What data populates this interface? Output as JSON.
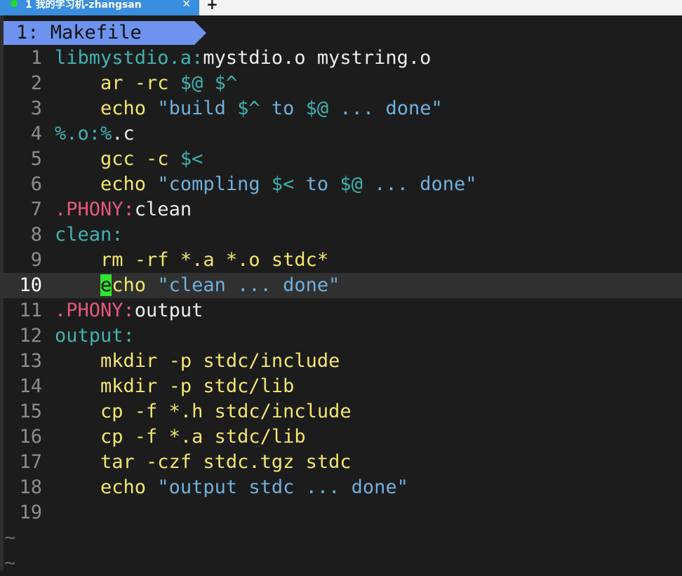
{
  "tab": {
    "title": "1 我的学习机-zhangsan",
    "close": "×",
    "new_tab": "+"
  },
  "buffer": {
    "label": "1: Makefile"
  },
  "lines": [
    {
      "n": "1",
      "segs": [
        [
          "t",
          "libmystdio.a:"
        ],
        [
          "w",
          "mystdio.o mystring.o"
        ]
      ]
    },
    {
      "n": "2",
      "segs": [
        [
          "w",
          "    "
        ],
        [
          "y",
          "ar -rc "
        ],
        [
          "t",
          "$@ $^"
        ]
      ]
    },
    {
      "n": "3",
      "segs": [
        [
          "w",
          "    "
        ],
        [
          "y",
          "echo "
        ],
        [
          "b",
          "\"build "
        ],
        [
          "t",
          "$^"
        ],
        [
          "b",
          " to "
        ],
        [
          "t",
          "$@"
        ],
        [
          "b",
          " ... done\""
        ]
      ]
    },
    {
      "n": "4",
      "segs": [
        [
          "t",
          "%.o:%"
        ],
        [
          "w",
          ".c"
        ]
      ]
    },
    {
      "n": "5",
      "segs": [
        [
          "w",
          "    "
        ],
        [
          "y",
          "gcc -c "
        ],
        [
          "t",
          "$<"
        ]
      ]
    },
    {
      "n": "6",
      "segs": [
        [
          "w",
          "    "
        ],
        [
          "y",
          "echo "
        ],
        [
          "b",
          "\"compling "
        ],
        [
          "t",
          "$<"
        ],
        [
          "b",
          " to "
        ],
        [
          "t",
          "$@"
        ],
        [
          "b",
          " ... done\""
        ]
      ]
    },
    {
      "n": "7",
      "segs": [
        [
          "m",
          ".PHONY:"
        ],
        [
          "w",
          "clean"
        ]
      ]
    },
    {
      "n": "8",
      "segs": [
        [
          "t",
          "clean:"
        ]
      ]
    },
    {
      "n": "9",
      "segs": [
        [
          "w",
          "    "
        ],
        [
          "y",
          "rm -rf *.a *.o stdc*"
        ]
      ]
    },
    {
      "n": "10",
      "current": true,
      "segs": [
        [
          "w",
          "    "
        ],
        [
          "cursor",
          "e"
        ],
        [
          "y",
          "cho "
        ],
        [
          "b",
          "\"clean ... done\""
        ]
      ]
    },
    {
      "n": "11",
      "segs": [
        [
          "m",
          ".PHONY:"
        ],
        [
          "w",
          "output"
        ]
      ]
    },
    {
      "n": "12",
      "segs": [
        [
          "t",
          "output:"
        ]
      ]
    },
    {
      "n": "13",
      "segs": [
        [
          "w",
          "    "
        ],
        [
          "y",
          "mkdir -p stdc/include"
        ]
      ]
    },
    {
      "n": "14",
      "segs": [
        [
          "w",
          "    "
        ],
        [
          "y",
          "mkdir -p stdc/lib"
        ]
      ]
    },
    {
      "n": "15",
      "segs": [
        [
          "w",
          "    "
        ],
        [
          "y",
          "cp -f *.h stdc/include"
        ]
      ]
    },
    {
      "n": "16",
      "segs": [
        [
          "w",
          "    "
        ],
        [
          "y",
          "cp -f *.a stdc/lib"
        ]
      ]
    },
    {
      "n": "17",
      "segs": [
        [
          "w",
          "    "
        ],
        [
          "y",
          "tar -czf stdc.tgz stdc"
        ]
      ]
    },
    {
      "n": "18",
      "segs": [
        [
          "w",
          "    "
        ],
        [
          "y",
          "echo "
        ],
        [
          "b",
          "\"output stdc ... done\""
        ]
      ]
    },
    {
      "n": "19",
      "segs": []
    }
  ],
  "empty_markers": [
    "~",
    "~"
  ],
  "colors": {
    "background": "#1c1c1c",
    "tab_bg": "#3a8ee0",
    "bufferline_bg": "#6d93ee",
    "cursorline_bg": "#303030",
    "cursor": "#2ee62e",
    "target_teal": "#3fb2b2",
    "command_yellow": "#f3e66a",
    "string_blue": "#6fb0de",
    "phony_pink": "#e6587c"
  }
}
